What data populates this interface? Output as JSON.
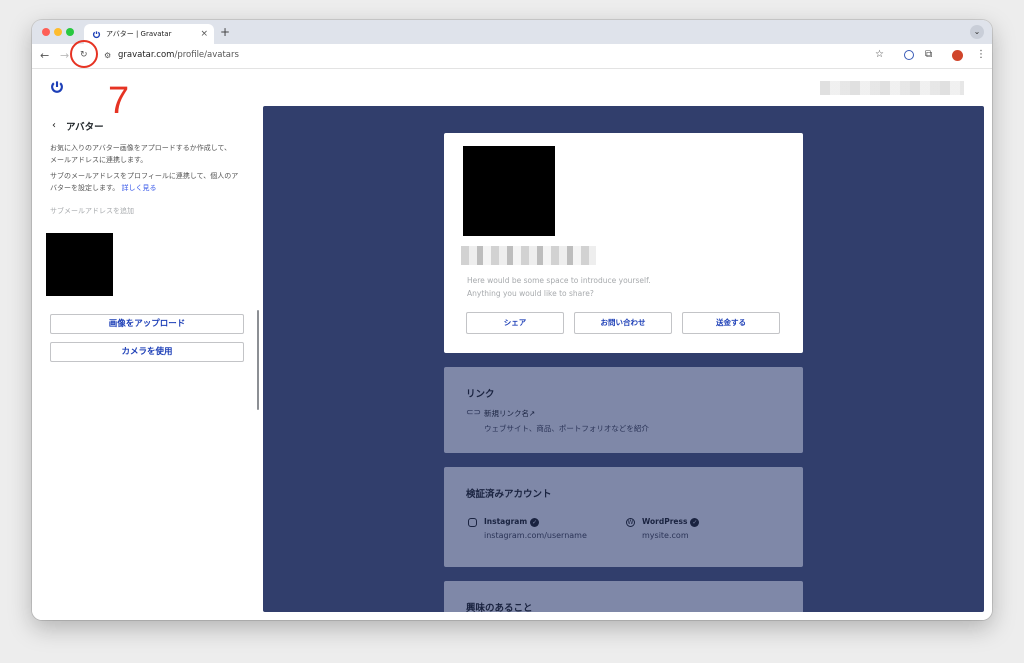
{
  "browser": {
    "tab_title": "アバター | Gravatar",
    "url_host": "gravatar.com",
    "url_path": "/profile/avatars",
    "new_tab": "+",
    "tab_close": "×"
  },
  "annotation": {
    "step_number": "7",
    "color": "#e63323"
  },
  "sidebar": {
    "title": "アバター",
    "desc1_line1": "お気に入りのアバター画像をアプロードするか作成して、",
    "desc1_line2": "メールアドレスに連携します。",
    "desc2_line1": "サブのメールアドレスをプロフィールに連携して、個人のア",
    "desc2_line2": "バターを設定します。",
    "learn_more": "詳しく見る",
    "add_email": "サブメールアドレスを追加",
    "upload_button": "画像をアップロード",
    "camera_button": "カメラを使用"
  },
  "preview": {
    "intro_line1": "Here would be some space to introduce yourself.",
    "intro_line2": "Anything you would like to share?",
    "share_button": "シェア",
    "contact_button": "お問い合わせ",
    "send_money_button": "送金する",
    "links_title": "リンク",
    "new_link_name": "新規リンク名↗",
    "link_desc": "ウェブサイト、商品、ポートフォリオなどを紹介",
    "verified_title": "検証済みアカウント",
    "accounts": [
      {
        "name": "Instagram",
        "url": "instagram.com/username"
      },
      {
        "name": "WordPress",
        "url": "mysite.com"
      }
    ],
    "interests_title": "興味のあること"
  },
  "colors": {
    "brand_blue": "#1d3fb7",
    "preview_bg": "#313e6c",
    "ghost_card": "#7f88a8"
  },
  "icons": [
    "back-arrow-icon",
    "forward-arrow-icon",
    "reload-icon",
    "site-settings-icon",
    "star-icon",
    "puzzle-icon",
    "kebab-menu-icon",
    "gravatar-logo-icon",
    "chevron-left-icon",
    "link-icon",
    "instagram-icon",
    "wordpress-icon",
    "verified-check-icon"
  ]
}
